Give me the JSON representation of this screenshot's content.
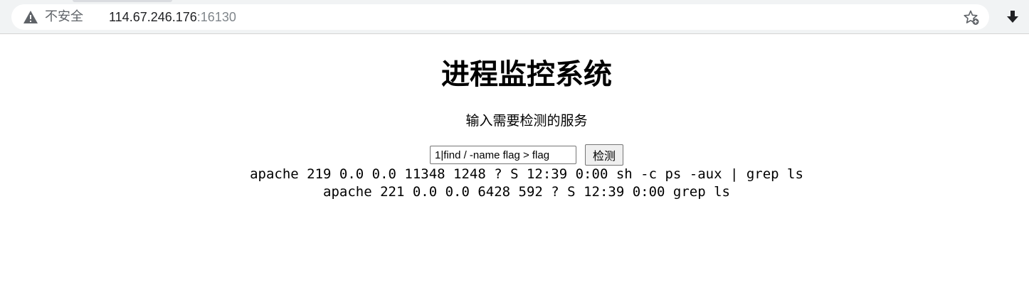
{
  "browser": {
    "security_label": "不安全",
    "url_host": "114.67.246.176",
    "url_port": ":16130",
    "icons": {
      "warning": "warning-triangle-icon",
      "bookmark": "bookmark-star-icon",
      "download": "download-arrow-icon"
    }
  },
  "page": {
    "title": "进程监控系统",
    "prompt": "输入需要检测的服务",
    "input_value": "1|find / -name flag > flag",
    "submit_label": "检测",
    "output_lines": [
      "apache 219 0.0 0.0 11348 1248 ? S 12:39 0:00 sh -c ps -aux | grep ls",
      "apache 221 0.0 0.0 6428 592 ? S 12:39 0:00 grep ls"
    ]
  },
  "colors": {
    "chrome_bg": "#f1f3f4",
    "omnibox_bg": "#ffffff",
    "security_text": "#5f6368",
    "url_port_text": "#80868b"
  }
}
